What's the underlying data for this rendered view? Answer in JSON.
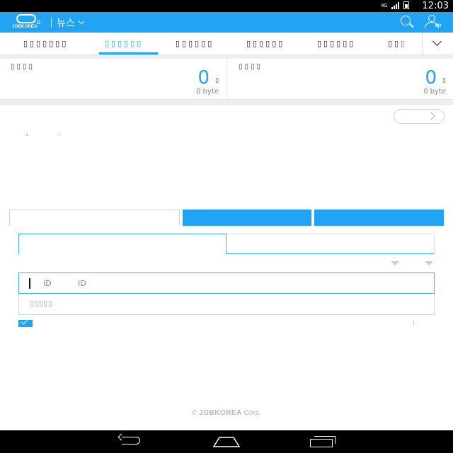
{
  "status_bar": {
    "network": "4G",
    "time": "12:03"
  },
  "header": {
    "logo_text": "JOBKOREA",
    "section_title": "뉴스",
    "my_label": "MY"
  },
  "tabs": [
    {
      "label": "▯▯▯▯▯▯▯",
      "active": false
    },
    {
      "label": "▯▯▯▯▯▯",
      "active": true
    },
    {
      "label": "▯▯▯▯▯▯",
      "active": false
    },
    {
      "label": "▯▯▯▯▯▯",
      "active": false
    },
    {
      "label": "▯▯▯▯▯▯",
      "active": false
    },
    {
      "label": "▯▯▯",
      "active": false
    }
  ],
  "stats": [
    {
      "label": "▯▯▯▯",
      "value": "0",
      "unit": "▯",
      "bytes": "0 byte"
    },
    {
      "label": "▯▯▯▯",
      "value": "0",
      "unit": "▯",
      "bytes": "0 byte"
    }
  ],
  "description": ", .",
  "login": {
    "id_placeholder_1": "ID",
    "id_placeholder_2": "ID",
    "password_placeholder": "▯▯▯▯▯",
    "auto_login_checked": true
  },
  "footer": {
    "copyright": "©",
    "brand": "JOBKOREA",
    "suffix": "Corp."
  },
  "colors": {
    "accent": "#21a4f4",
    "status_bar": "#000000"
  }
}
